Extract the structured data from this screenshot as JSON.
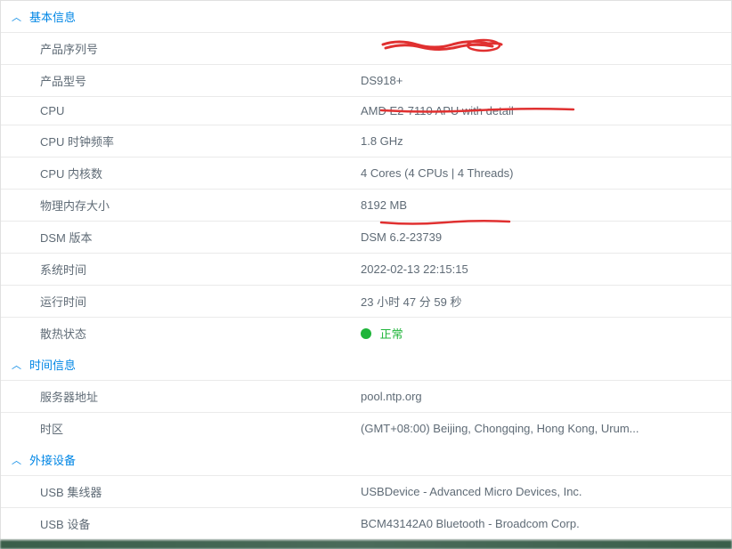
{
  "sections": {
    "basic": {
      "title": "基本信息",
      "rows": {
        "serial": {
          "label": "产品序列号",
          "value": ""
        },
        "model": {
          "label": "产品型号",
          "value": "DS918+"
        },
        "cpu": {
          "label": "CPU",
          "value": "AMD E2-7110 APU with detail"
        },
        "cpu_clock": {
          "label": "CPU 时钟频率",
          "value": "1.8 GHz"
        },
        "cpu_cores": {
          "label": "CPU 内核数",
          "value": "4 Cores (4 CPUs | 4 Threads)"
        },
        "memory": {
          "label": "物理内存大小",
          "value": "8192 MB"
        },
        "dsm": {
          "label": "DSM 版本",
          "value": "DSM 6.2-23739"
        },
        "systime": {
          "label": "系统时间",
          "value": "2022-02-13 22:15:15"
        },
        "uptime": {
          "label": "运行时间",
          "value": "23 小时 47 分 59 秒"
        },
        "thermal": {
          "label": "散热状态",
          "value": "正常",
          "status_color": "#1fb53a"
        }
      }
    },
    "time": {
      "title": "时间信息",
      "rows": {
        "ntp": {
          "label": "服务器地址",
          "value": "pool.ntp.org"
        },
        "tz": {
          "label": "时区",
          "value": "(GMT+08:00) Beijing, Chongqing, Hong Kong, Urum..."
        }
      }
    },
    "external": {
      "title": "外接设备",
      "rows": {
        "usb_hub": {
          "label": "USB 集线器",
          "value": "USBDevice - Advanced Micro Devices, Inc."
        },
        "usb_dev": {
          "label": "USB 设备",
          "value": "BCM43142A0 Bluetooth - Broadcom Corp."
        }
      }
    }
  }
}
